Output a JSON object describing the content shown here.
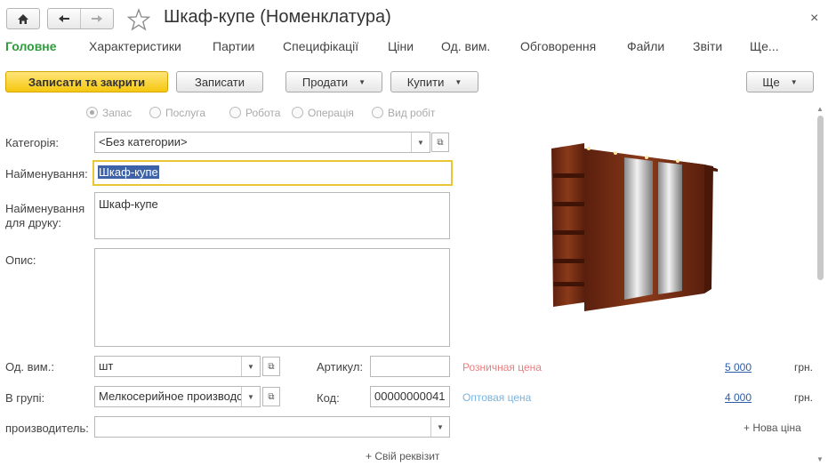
{
  "window": {
    "title": "Шкаф-купе (Номенклатура)",
    "close_glyph": "×",
    "home_icon": "home-icon",
    "back_icon": "arrow-left-icon",
    "forward_icon": "arrow-right-icon",
    "favorite_icon": "star-icon"
  },
  "tabs": [
    {
      "label": "Головне",
      "active": true
    },
    {
      "label": "Характеристики"
    },
    {
      "label": "Партии"
    },
    {
      "label": "Специфікації"
    },
    {
      "label": "Ціни"
    },
    {
      "label": "Од. вим."
    },
    {
      "label": "Обговорення"
    },
    {
      "label": "Файли"
    },
    {
      "label": "Звіти"
    },
    {
      "label": "Ще..."
    }
  ],
  "toolbar": {
    "save_close": "Записати та закрити",
    "save": "Записати",
    "sell": "Продати",
    "buy": "Купити",
    "more": "Ще"
  },
  "radio": {
    "options": [
      "Запас",
      "Послуга",
      "Робота",
      "Операція",
      "Вид робіт"
    ],
    "selected": "Запас"
  },
  "form": {
    "category_label": "Категорія:",
    "category_value": "<Без категории>",
    "name_label": "Найменування:",
    "name_value": "Шкаф-купе",
    "print_name_label_1": "Найменування",
    "print_name_label_2": "для друку:",
    "print_name_value": "Шкаф-купе",
    "description_label": "Опис:",
    "description_value": "",
    "unit_label": "Од. вим.:",
    "unit_value": "шт",
    "group_label": "В групі:",
    "group_value": "Мелкосерийное производс",
    "manufacturer_label": "производитель:",
    "manufacturer_value": "",
    "article_label": "Артикул:",
    "article_value": "",
    "code_label": "Код:",
    "code_value": "00000000041",
    "custom_attr_link": "+ Свій реквізит"
  },
  "prices": {
    "retail_label": "Розничная цена",
    "retail_value": "5 000",
    "retail_color": "#e88080",
    "wholesale_label": "Оптовая цена",
    "wholesale_value": "4 000",
    "wholesale_color": "#7ab4e0",
    "currency": "грн.",
    "new_price_link": "+ Нова ціна"
  },
  "colors": {
    "accent_green": "#2e9b3a",
    "primary_button": "#f5c710",
    "link_blue": "#2d5ea8"
  }
}
